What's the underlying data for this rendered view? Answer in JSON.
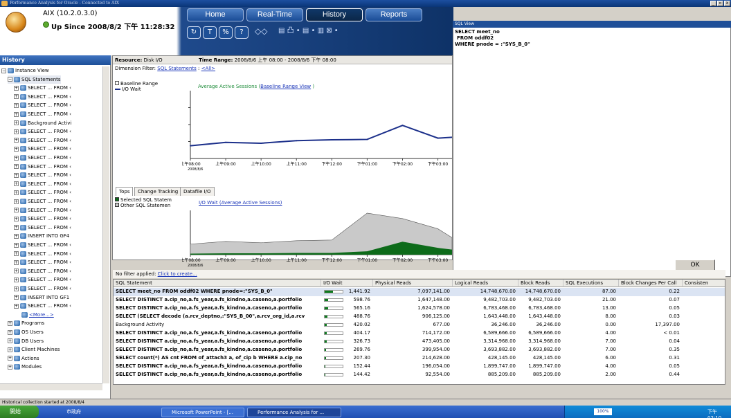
{
  "window": {
    "title": "Performance Analysis for Oracle - Connected to AIX",
    "min": "_",
    "max": "▫",
    "close": "x"
  },
  "header": {
    "db_name": "AIX (10.2.0.3.0)",
    "up_since": "Up Since 2008/8/2 下午 11:28:32"
  },
  "nav": {
    "home": "Home",
    "realtime": "Real-Time",
    "history": "History",
    "reports": "Reports"
  },
  "toolbar": {
    "b1": "↻",
    "b2": "T",
    "b3": "%",
    "b4": "?",
    "g1": "◇◇",
    "g2": "▤ 凸 • ▤ • ▥ ⊠ •"
  },
  "history_panel": {
    "title": "History",
    "tree": [
      {
        "label": "Instance View",
        "level": 0,
        "expander": "−"
      },
      {
        "label": "SQL Statements",
        "level": 1,
        "expander": "−"
      },
      {
        "label": "SELECT ... FROM ‹",
        "level": 2,
        "expander": "+"
      },
      {
        "label": "SELECT ... FROM ‹",
        "level": 2,
        "expander": "+"
      },
      {
        "label": "SELECT ... FROM ‹",
        "level": 2,
        "expander": "+"
      },
      {
        "label": "SELECT ... FROM ‹",
        "level": 2,
        "expander": "+"
      },
      {
        "label": "Background Activi",
        "level": 2,
        "expander": "+"
      },
      {
        "label": "SELECT ... FROM ‹",
        "level": 2,
        "expander": "+"
      },
      {
        "label": "SELECT ... FROM ‹",
        "level": 2,
        "expander": "+"
      },
      {
        "label": "SELECT ... FROM ‹",
        "level": 2,
        "expander": "+"
      },
      {
        "label": "SELECT ... FROM ‹",
        "level": 2,
        "expander": "+"
      },
      {
        "label": "SELECT ... FROM ‹",
        "level": 2,
        "expander": "+"
      },
      {
        "label": "SELECT ... FROM ‹",
        "level": 2,
        "expander": "+"
      },
      {
        "label": "SELECT ... FROM ‹",
        "level": 2,
        "expander": "+"
      },
      {
        "label": "SELECT ... FROM ‹",
        "level": 2,
        "expander": "+"
      },
      {
        "label": "SELECT ... FROM ‹",
        "level": 2,
        "expander": "+"
      },
      {
        "label": "SELECT ... FROM ‹",
        "level": 2,
        "expander": "+"
      },
      {
        "label": "SELECT ... FROM ‹",
        "level": 2,
        "expander": "+"
      },
      {
        "label": "SELECT ... FROM ‹",
        "level": 2,
        "expander": "+"
      },
      {
        "label": "INSERT  INTO GF4",
        "level": 2,
        "expander": "+"
      },
      {
        "label": "SELECT ... FROM ‹",
        "level": 2,
        "expander": "+"
      },
      {
        "label": "SELECT ... FROM ‹",
        "level": 2,
        "expander": "+"
      },
      {
        "label": "SELECT ... FROM ‹",
        "level": 2,
        "expander": "+"
      },
      {
        "label": "SELECT ... FROM ‹",
        "level": 2,
        "expander": "+"
      },
      {
        "label": "SELECT ... FROM ‹",
        "level": 2,
        "expander": "+"
      },
      {
        "label": "SELECT ... FROM ‹",
        "level": 2,
        "expander": "+"
      },
      {
        "label": "INSERT  INTO GF1",
        "level": 2,
        "expander": "+"
      },
      {
        "label": "SELECT ... FROM ‹",
        "level": 2,
        "expander": "+"
      },
      {
        "label": "<More...>",
        "level": 2,
        "expander": ""
      },
      {
        "label": "Programs",
        "level": 1,
        "expander": "+"
      },
      {
        "label": "OS Users",
        "level": 1,
        "expander": "+"
      },
      {
        "label": "DB Users",
        "level": 1,
        "expander": "+"
      },
      {
        "label": "Client Machines",
        "level": 1,
        "expander": "+"
      },
      {
        "label": "Actions",
        "level": 1,
        "expander": "+"
      },
      {
        "label": "Modules",
        "level": 1,
        "expander": "+"
      }
    ]
  },
  "resource_bar": {
    "resource_label": "Resource:",
    "resource_value": "Disk I/O",
    "time_label": "Time Range:",
    "time_value": "2008/8/6 上午 08:00 - 2008/8/6 下午 08:00"
  },
  "dimension_filter": {
    "label": "Dimension Filter:",
    "sql": "SQL Statements",
    "sep": ":",
    "all": "<All>"
  },
  "chart1": {
    "legend": {
      "baseline": "Baseline Range",
      "io_wait": "I/O Wait"
    },
    "title_a": "Average Active Sessions (",
    "title_b": "Baseline Range View",
    "title_c": " )",
    "color": "#1b2f8a"
  },
  "tabs": {
    "tops": "Tops",
    "change_tracking": "Change Tracking",
    "datafile_io": "Datafile I/O"
  },
  "chart2": {
    "legend": {
      "selected": "Selected SQL Statem",
      "other": "Other SQL Statemen"
    },
    "title": "I/O Wait (Average Active Sessions)",
    "selected_color": "#0d6b1a",
    "other_color": "#c9c9c9"
  },
  "time_axis": {
    "ticks": [
      "上午08:00",
      "上午09:00",
      "上午10:00",
      "上午11:00",
      "下午12:00",
      "下午01:00",
      "下午02:00",
      "下午03:00"
    ],
    "date": "2008/8/6"
  },
  "chart_data": [
    {
      "type": "line",
      "title": "Average Active Sessions ( Baseline Range View )",
      "x": [
        "上午08:00",
        "上午09:00",
        "上午10:00",
        "上午11:00",
        "下午12:00",
        "下午01:00",
        "下午02:00",
        "下午03:00"
      ],
      "series": [
        {
          "name": "I/O Wait",
          "values": [
            0.3,
            0.38,
            0.36,
            0.42,
            0.44,
            0.45,
            0.78,
            0.48
          ]
        }
      ],
      "ylim": [
        0,
        1.6
      ]
    },
    {
      "type": "area",
      "title": "I/O Wait (Average Active Sessions)",
      "x": [
        "上午08:00",
        "上午09:00",
        "上午10:00",
        "上午11:00",
        "下午12:00",
        "下午01:00",
        "下午02:00",
        "下午03:00"
      ],
      "series": [
        {
          "name": "Selected SQL Statem",
          "values": [
            0.03,
            0.04,
            0.04,
            0.05,
            0.05,
            0.1,
            0.38,
            0.2
          ]
        },
        {
          "name": "Other SQL Statemen",
          "values": [
            0.28,
            0.35,
            0.31,
            0.36,
            0.38,
            1.12,
            0.68,
            0.56
          ]
        }
      ],
      "ylim": [
        0,
        1.3
      ]
    }
  ],
  "filter": {
    "text": "No filter applied:",
    "link": "Click to create..."
  },
  "table": {
    "columns": [
      "SQL Statement",
      "I/O Wait",
      "Physical Reads",
      "Logical Reads",
      "Block Reads",
      "SQL Executions",
      "Block Changes Per Call",
      "Consisten"
    ],
    "rows": [
      {
        "sql": "SELECT meet_no FROM oddf02 WHERE pnode=:\"SYS_B_0\"",
        "io": 1441.92,
        "io_text": "1,441.92",
        "phys": "7,097,141.00",
        "logical": "14,748,670.00",
        "block": "14,748,670.00",
        "exec": "87.00",
        "bcpc": "0.22",
        "sel": true
      },
      {
        "sql": "SELECT DISTINCT a.cip_no,a.fs_year,a.fs_kindno,a.caseno,a.portfolio",
        "io": 598.76,
        "io_text": "598.76",
        "phys": "1,647,148.00",
        "logical": "9,482,703.00",
        "block": "9,482,703.00",
        "exec": "21.00",
        "bcpc": "0.07"
      },
      {
        "sql": "SELECT DISTINCT a.cip_no,a.fs_year,a.fs_kindno,a.caseno,a.portfolio",
        "io": 565.16,
        "io_text": "565.16",
        "phys": "1,624,578.00",
        "logical": "6,783,468.00",
        "block": "6,783,468.00",
        "exec": "13.00",
        "bcpc": "0.05"
      },
      {
        "sql": "SELECT (SELECT decode (a.rcv_deptno,:\"SYS_B_00\",a.rcv_org_id,a.rcv",
        "io": 488.76,
        "io_text": "488.76",
        "phys": "906,125.00",
        "logical": "1,643,448.00",
        "block": "1,643,448.00",
        "exec": "8.00",
        "bcpc": "0.03"
      },
      {
        "sql": "Background Activity",
        "io": 420.02,
        "io_text": "420.02",
        "phys": "677.00",
        "logical": "36,246.00",
        "block": "36,246.00",
        "exec": "0.00",
        "bcpc": "17,397.00"
      },
      {
        "sql": "SELECT DISTINCT a.cip_no,a.fs_year,a.fs_kindno,a.caseno,a.portfolio",
        "io": 404.17,
        "io_text": "404.17",
        "phys": "714,172.00",
        "logical": "6,589,666.00",
        "block": "6,589,666.00",
        "exec": "4.00",
        "bcpc": "< 0.01"
      },
      {
        "sql": "SELECT DISTINCT a.cip_no,a.fs_year,a.fs_kindno,a.caseno,a.portfolio",
        "io": 326.73,
        "io_text": "326.73",
        "phys": "473,405.00",
        "logical": "3,314,968.00",
        "block": "3,314,968.00",
        "exec": "7.00",
        "bcpc": "0.04"
      },
      {
        "sql": "SELECT DISTINCT a.cip_no,a.fs_year,a.fs_kindno,a.caseno,a.portfolio",
        "io": 269.76,
        "io_text": "269.76",
        "phys": "399,954.00",
        "logical": "3,693,882.00",
        "block": "3,693,882.00",
        "exec": "7.00",
        "bcpc": "0.35"
      },
      {
        "sql": "SELECT count(*) AS cnt FROM of_attach3 a, of_cip b WHERE a.cip_no",
        "io": 207.3,
        "io_text": "207.30",
        "phys": "214,628.00",
        "logical": "428,145.00",
        "block": "428,145.00",
        "exec": "6.00",
        "bcpc": "0.31"
      },
      {
        "sql": "SELECT DISTINCT a.cip_no,a.fs_year,a.fs_kindno,a.caseno,a.portfolio",
        "io": 152.44,
        "io_text": "152.44",
        "phys": "196,054.00",
        "logical": "1,899,747.00",
        "block": "1,899,747.00",
        "exec": "4.00",
        "bcpc": "0.05"
      },
      {
        "sql": "SELECT DISTINCT a.cip_no,a.fs_year,a.fs_kindno,a.caseno,a.portfolio",
        "io": 144.42,
        "io_text": "144.42",
        "phys": "92,554.00",
        "logical": "885,209.00",
        "block": "885,209.00",
        "exec": "2.00",
        "bcpc": "0.44"
      }
    ]
  },
  "sql_view": {
    "title": "SQL View",
    "line1": "SELECT meet_no",
    "line2": "FROM oddf02",
    "line3": "WHERE pnode = :\"SYS_B_0\"",
    "ok": "OK"
  },
  "status": {
    "text": "Historical collection started at 2008/8/4"
  },
  "taskbar": {
    "start": "開始",
    "folder": "市政府",
    "ppt": "Microsoft PowerPoint - [...",
    "app": "Performance Analysis for ...",
    "zoom": "100%",
    "clock": "下午 02:10"
  }
}
